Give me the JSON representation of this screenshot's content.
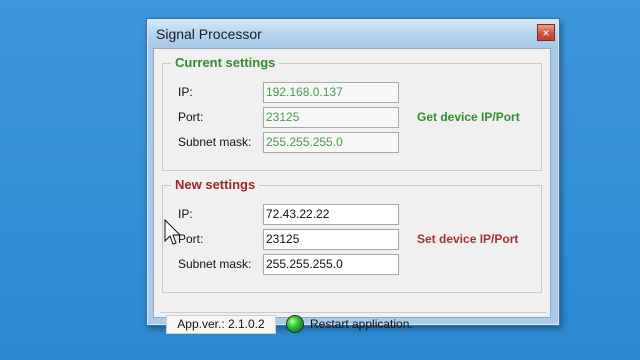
{
  "colors": {
    "desktop": "#2f8fd7",
    "window_frame": "#a9cae8",
    "current_accent": "#2f8f2f",
    "new_accent": "#9f2626",
    "status_led": "#37c83a"
  },
  "window": {
    "title": "Signal Processor",
    "close_label": "×"
  },
  "current_settings": {
    "legend": "Current settings",
    "ip_label": "IP:",
    "ip_value": "192.168.0.137",
    "port_label": "Port:",
    "port_value": "23125",
    "subnet_label": "Subnet mask:",
    "subnet_value": "255.255.255.0",
    "action_label": "Get device IP/Port"
  },
  "new_settings": {
    "legend": "New settings",
    "ip_label": "IP:",
    "ip_value": "72.43.22.22",
    "port_label": "Port:",
    "port_value": "23125",
    "subnet_label": "Subnet mask:",
    "subnet_value": "255.255.255.0",
    "action_label": "Set device IP/Port"
  },
  "status": {
    "app_version": "App.ver.: 2.1.0.2",
    "restart_text": "Restart application."
  },
  "icons": {
    "close": "close-icon",
    "status": "status-led-icon",
    "pointer": "mouse-pointer-icon"
  }
}
